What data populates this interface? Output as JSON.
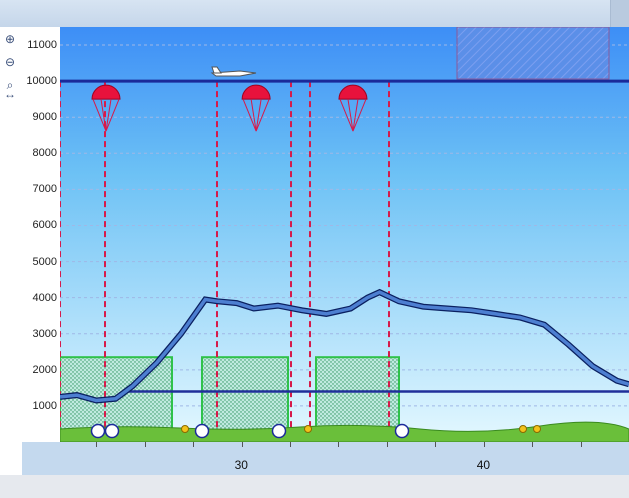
{
  "toolbar": {
    "items": [
      {
        "icon": "zoom-in-icon",
        "glyph": "⊕"
      },
      {
        "icon": "zoom-out-icon",
        "glyph": "⊖"
      },
      {
        "icon": "zoom-range-icon",
        "glyph": "⌕"
      },
      {
        "icon": "horizontal-resize-icon",
        "glyph": "↔"
      }
    ]
  },
  "y_axis": {
    "min": 0,
    "max": 11500,
    "ticks": [
      "1000",
      "2000",
      "3000",
      "4000",
      "5000",
      "6000",
      "7000",
      "8000",
      "9000",
      "10000",
      "11000"
    ]
  },
  "x_axis": {
    "min": 22.5,
    "max": 46.0,
    "ticks": [
      {
        "value": 30,
        "label": "30"
      },
      {
        "value": 40,
        "label": "40"
      }
    ]
  },
  "chart_data": {
    "type": "line",
    "x_labels": [
      "30",
      "40"
    ],
    "jump_altitude": 10000,
    "series": [
      {
        "x": [
          22.5,
          23.2,
          24.0,
          24.8,
          25.5,
          26.5,
          27.5,
          28.5,
          29.0,
          29.8,
          30.5,
          31.5,
          32.5,
          33.5,
          34.5,
          35.2,
          35.7,
          36.5,
          37.5,
          38.5,
          39.5,
          40.5,
          41.5,
          42.5,
          43.5,
          44.5,
          45.5,
          46.0
        ],
        "y": [
          1250,
          1300,
          1150,
          1200,
          1550,
          2200,
          3000,
          3950,
          3900,
          3850,
          3700,
          3780,
          3650,
          3550,
          3700,
          4000,
          4150,
          3900,
          3750,
          3700,
          3650,
          3550,
          3450,
          3250,
          2700,
          2100,
          1700,
          1600
        ]
      }
    ],
    "drops": [
      24.4,
      30.6,
      34.6
    ],
    "colors": {
      "sky_top": "#3d8ef6",
      "sky_bottom": "#e4f8ff",
      "terrain": "#6abf3a",
      "profile": "#4d7fd1",
      "profile_edge": "#0a2060",
      "airspace": "#1f2f9a",
      "drop": "#d61a4a",
      "cloud": "#2fc24a"
    }
  }
}
